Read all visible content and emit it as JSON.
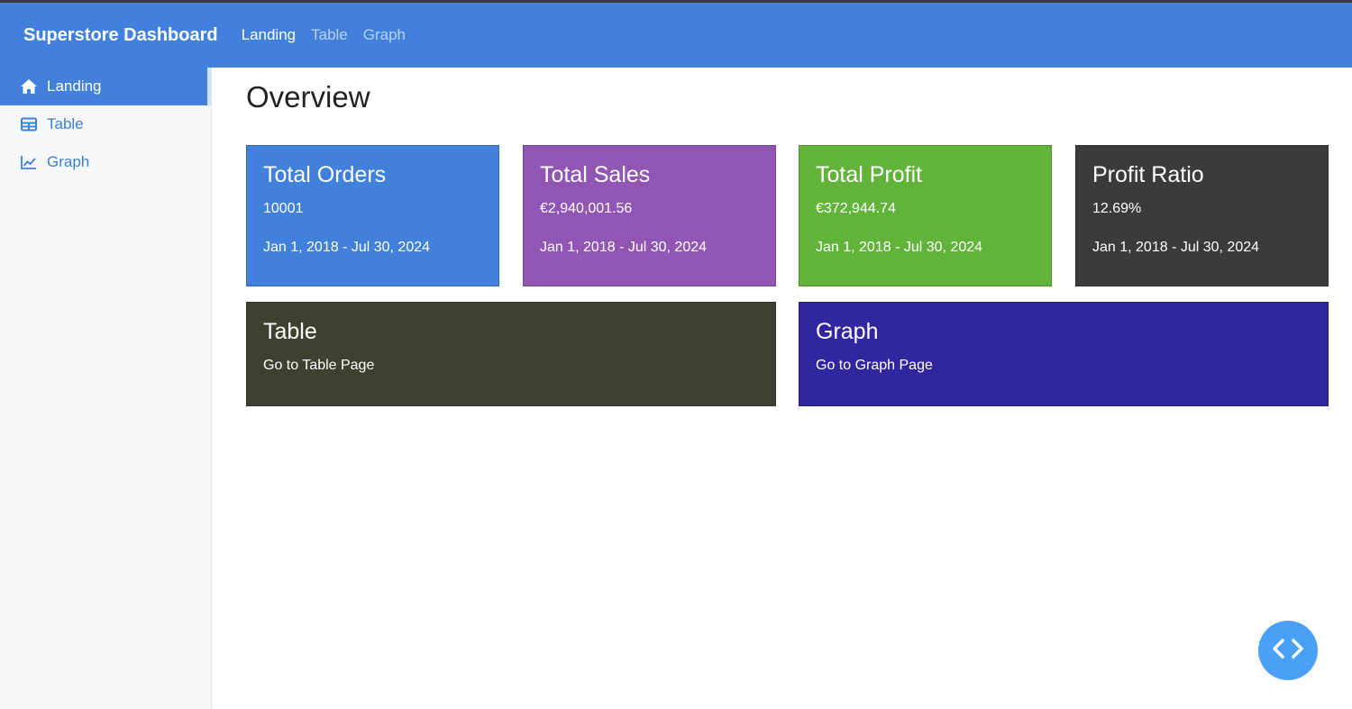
{
  "navbar": {
    "brand": "Superstore Dashboard",
    "links": [
      {
        "label": "Landing",
        "active": true
      },
      {
        "label": "Table",
        "active": false
      },
      {
        "label": "Graph",
        "active": false
      }
    ],
    "color": "#4181dc"
  },
  "sidebar": {
    "items": [
      {
        "label": "Landing",
        "icon": "home-icon",
        "active": true
      },
      {
        "label": "Table",
        "icon": "table-icon",
        "active": false
      },
      {
        "label": "Graph",
        "icon": "line-chart-icon",
        "active": false
      }
    ]
  },
  "main": {
    "title": "Overview",
    "cards": [
      {
        "title": "Total Orders",
        "value": "10001",
        "range": "Jan 1, 2018 - Jul 30, 2024",
        "color": "#4181dc"
      },
      {
        "title": "Total Sales",
        "value": "€2,940,001.56",
        "range": "Jan 1, 2018 - Jul 30, 2024",
        "color": "#9156b4"
      },
      {
        "title": "Total Profit",
        "value": "€372,944.74",
        "range": "Jan 1, 2018 - Jul 30, 2024",
        "color": "#62b33a"
      },
      {
        "title": "Profit Ratio",
        "value": "12.69%",
        "range": "Jan 1, 2018 - Jul 30, 2024",
        "color": "#3a3b3d"
      }
    ],
    "links": [
      {
        "title": "Table",
        "subtitle": "Go to Table Page",
        "color": "#3d412f"
      },
      {
        "title": "Graph",
        "subtitle": "Go to Graph Page",
        "color": "#3225a0"
      }
    ]
  },
  "fab": {
    "icon": "code-icon",
    "color": "#4a9ff7"
  }
}
